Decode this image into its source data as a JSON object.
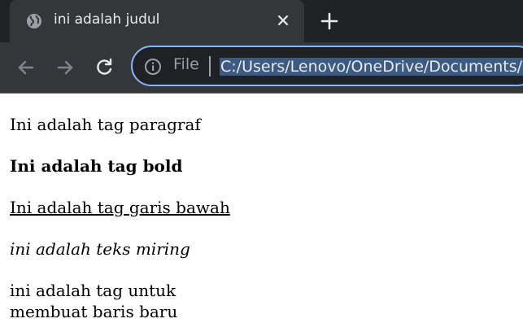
{
  "tab": {
    "title": "ini adalah judul",
    "favicon_icon": "globe-icon",
    "close_icon": "close-icon"
  },
  "new_tab_icon": "plus-icon",
  "toolbar": {
    "back_icon": "arrow-left-icon",
    "forward_icon": "arrow-right-icon",
    "reload_icon": "reload-icon",
    "info_icon": "info-icon",
    "scheme_label": "File",
    "url": "C:/Users/Lenovo/OneDrive/Documents/b"
  },
  "colors": {
    "tabstrip_bg": "#202124",
    "active_tab_bg": "#35363a",
    "omnibox_focus": "#8ab4f8",
    "url_selection": "#3d5a80"
  },
  "content": {
    "paragraph": "Ini adalah tag paragraf",
    "bold": "Ini adalah tag bold",
    "underline": "Ini adalah tag garis bawah",
    "italic": "ini adalah teks miring",
    "linebreak_line1": "ini adalah tag untuk",
    "linebreak_line2": "membuat baris baru"
  }
}
